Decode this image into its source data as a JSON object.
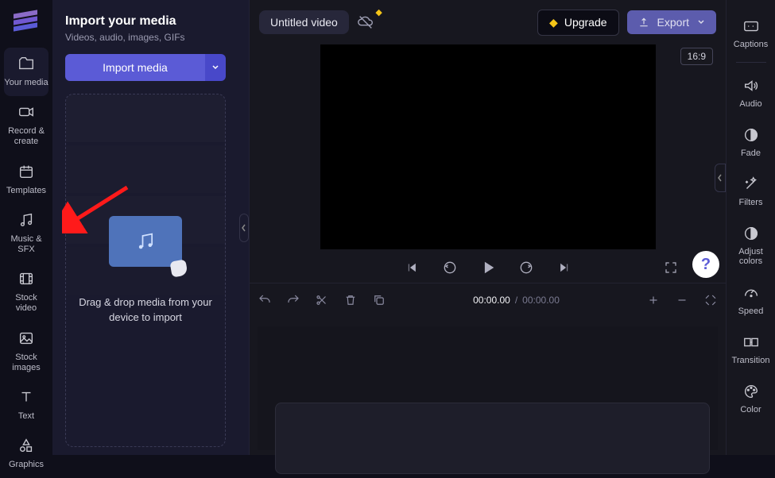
{
  "left_rail": {
    "items": [
      {
        "label": "Your media"
      },
      {
        "label": "Record & create"
      },
      {
        "label": "Templates"
      },
      {
        "label": "Music & SFX"
      },
      {
        "label": "Stock video"
      },
      {
        "label": "Stock images"
      },
      {
        "label": "Text"
      },
      {
        "label": "Graphics"
      }
    ]
  },
  "media_panel": {
    "title": "Import your media",
    "subtitle": "Videos, audio, images, GIFs",
    "import_label": "Import media",
    "dropzone_text": "Drag & drop media from your device to import"
  },
  "topbar": {
    "title": "Untitled video",
    "upgrade_label": "Upgrade",
    "export_label": "Export",
    "aspect_label": "16:9"
  },
  "player": {
    "help_glyph": "?"
  },
  "timeline": {
    "timecode_current": "00:00.00",
    "timecode_sep": " / ",
    "timecode_total": "00:00.00"
  },
  "right_rail": {
    "items": [
      {
        "label": "Captions"
      },
      {
        "label": "Audio"
      },
      {
        "label": "Fade"
      },
      {
        "label": "Filters"
      },
      {
        "label": "Adjust colors"
      },
      {
        "label": "Speed"
      },
      {
        "label": "Transition"
      },
      {
        "label": "Color"
      }
    ]
  }
}
